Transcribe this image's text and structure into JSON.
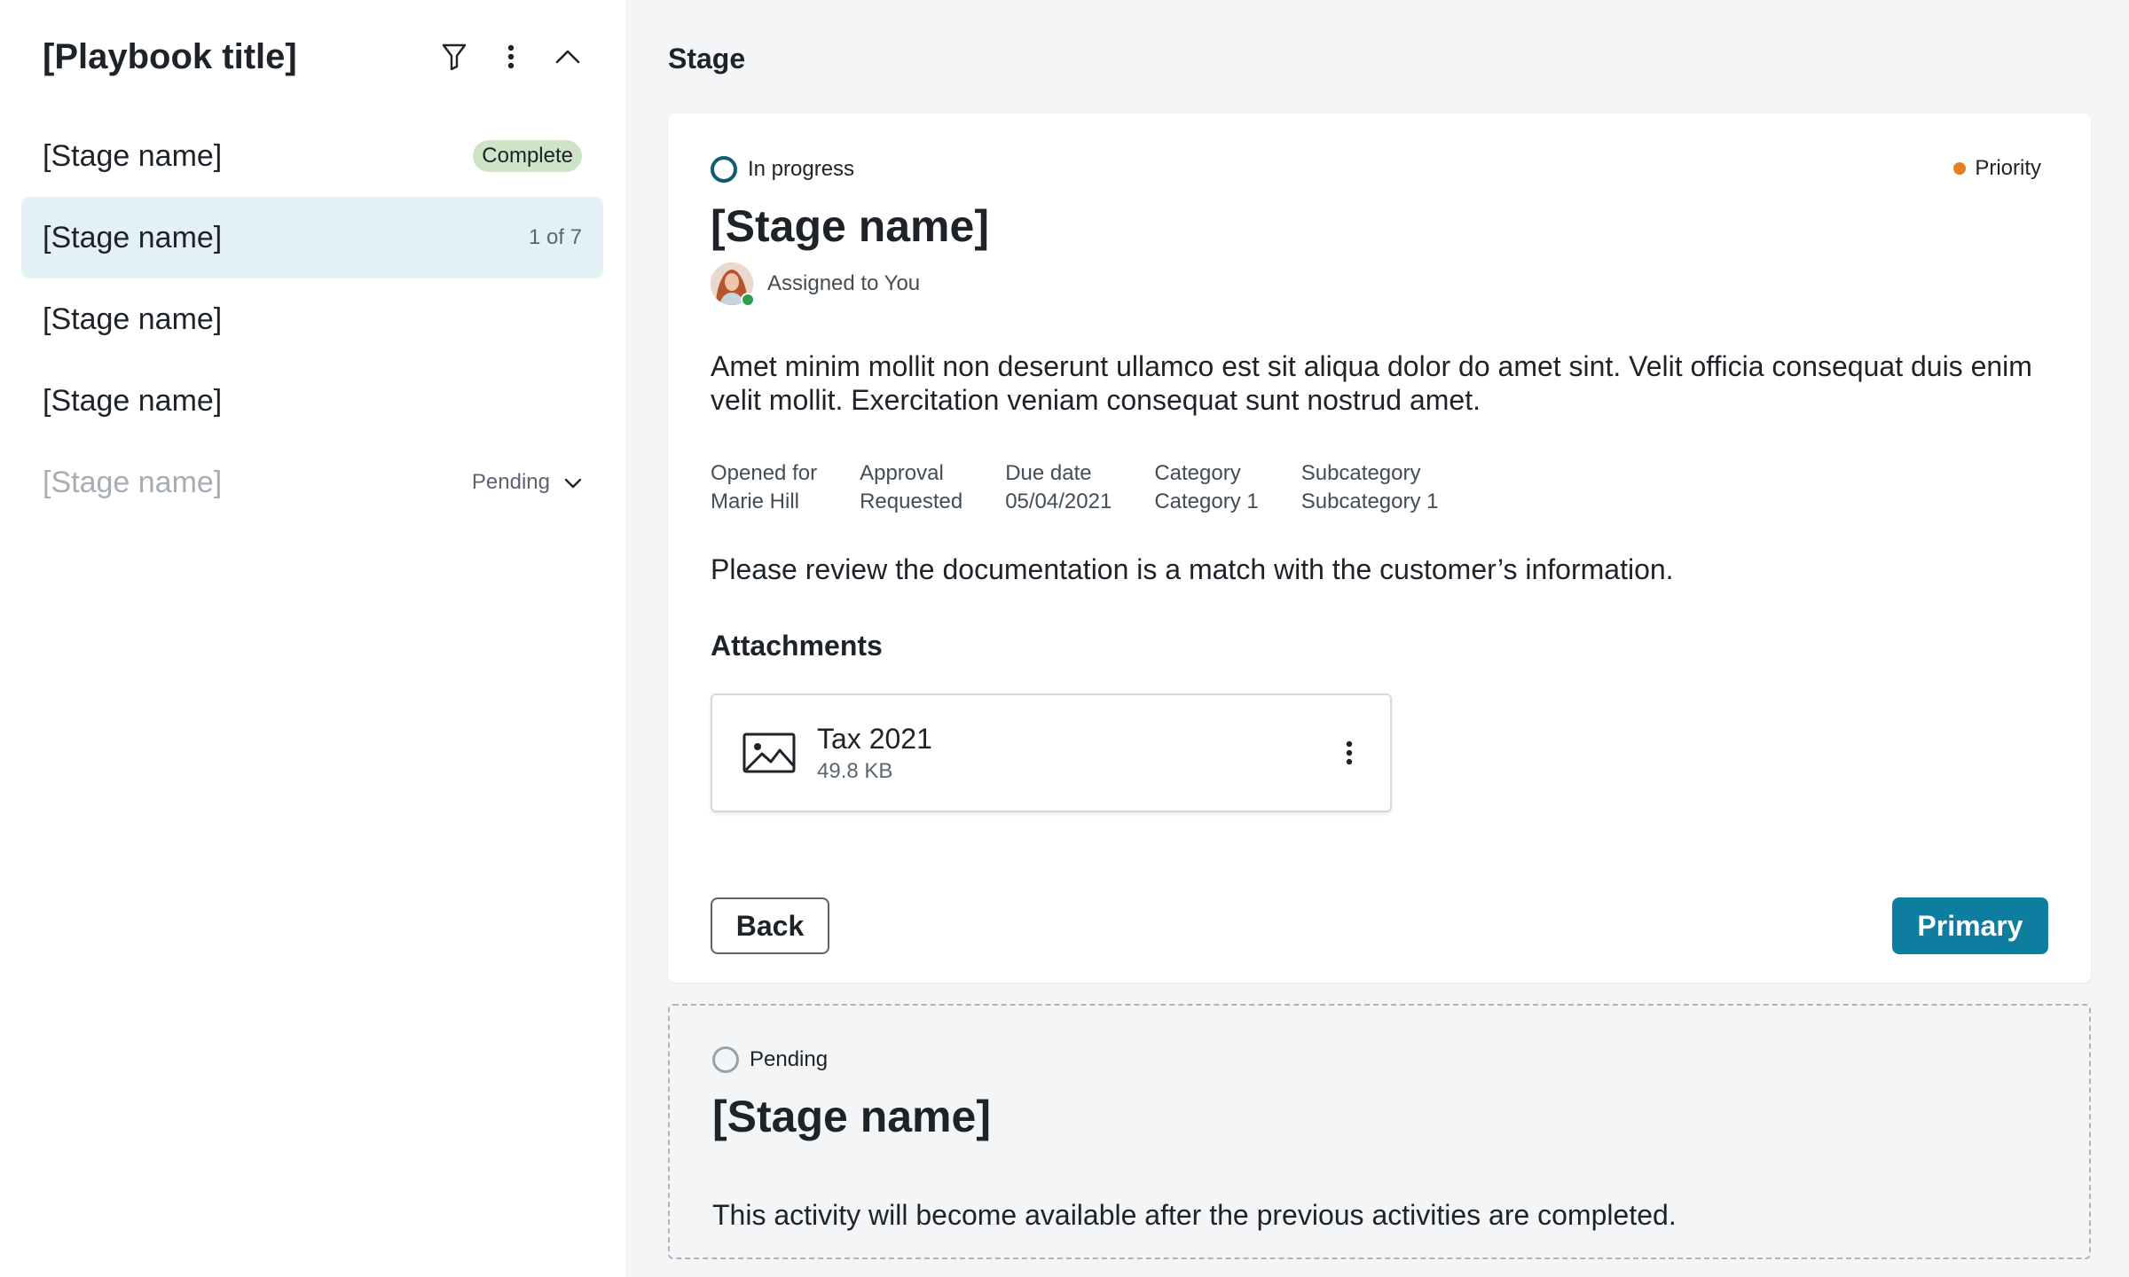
{
  "sidebar": {
    "title": "[Playbook title]",
    "items": [
      {
        "label": "[Stage name]",
        "badge": "Complete"
      },
      {
        "label": "[Stage name]",
        "count": "1 of 7"
      },
      {
        "label": "[Stage name]"
      },
      {
        "label": "[Stage name]"
      },
      {
        "label": "[Stage name]",
        "status": "Pending"
      }
    ]
  },
  "main": {
    "section_title": "Stage",
    "current": {
      "status": "In progress",
      "priority": "Priority",
      "title": "[Stage name]",
      "assignee": "Assigned to You",
      "description": "Amet minim mollit non deserunt ullamco est sit aliqua dolor do amet sint. Velit officia consequat duis enim velit mollit. Exercitation veniam consequat sunt nostrud amet.",
      "meta": [
        {
          "label": "Opened for",
          "value": "Marie Hill"
        },
        {
          "label": "Approval",
          "value": "Requested"
        },
        {
          "label": "Due date",
          "value": "05/04/2021"
        },
        {
          "label": "Category",
          "value": "Category 1"
        },
        {
          "label": "Subcategory",
          "value": "Subcategory 1"
        }
      ],
      "instruction": "Please review the documentation is a match with the customer’s information.",
      "attachments_heading": "Attachments",
      "attachment": {
        "name": "Tax 2021",
        "size": "49.8 KB"
      },
      "back_label": "Back",
      "primary_label": "Primary"
    },
    "next": {
      "status": "Pending",
      "title": "[Stage name]",
      "note": "This activity will become available after the previous activities are completed."
    }
  },
  "colors": {
    "accent": "#0d7da0",
    "active_bg": "#e3f1f5",
    "complete_badge": "#cfe3c6",
    "priority_dot": "#e67e22",
    "in_progress_ring": "#0e5b73"
  }
}
